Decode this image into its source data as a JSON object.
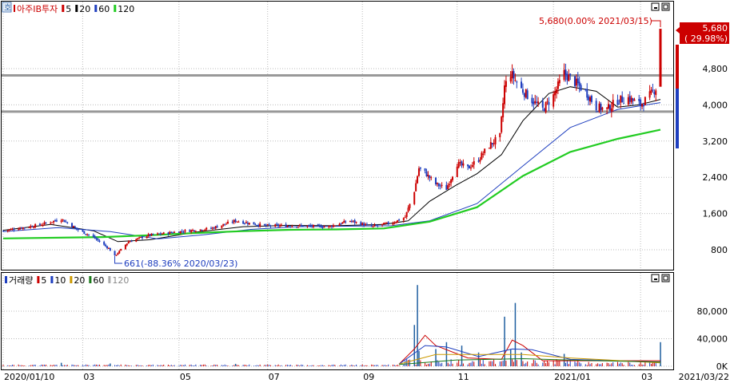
{
  "main_panel": {
    "corner_label": "호",
    "legend": [
      {
        "text": "아주IB투자",
        "color": "#cc0000"
      },
      {
        "text": "5",
        "color": "#000000",
        "swatch": "#cc0000"
      },
      {
        "text": "20",
        "color": "#000000",
        "swatch": "#000000"
      },
      {
        "text": "60",
        "color": "#000000",
        "swatch": "#1f3fbf"
      },
      {
        "text": "120",
        "color": "#000000",
        "swatch": "#22cc22"
      }
    ],
    "max_annotation": "5,680(0.00% 2021/03/15)",
    "min_annotation": "661(-88.36% 2020/03/23)",
    "last_price_label": "5,680",
    "last_change_label": "( 29.98%)"
  },
  "volume_panel": {
    "legend": [
      {
        "text": "거래량",
        "swatch": "#1f3fbf"
      },
      {
        "text": "5",
        "swatch": "#cc0000"
      },
      {
        "text": "10",
        "swatch": "#1f3fbf"
      },
      {
        "text": "20",
        "swatch": "#cc9900"
      },
      {
        "text": "60",
        "swatch": "#1a7a1a"
      },
      {
        "text": "120",
        "swatch": "#aaaaaa"
      }
    ]
  },
  "x_axis": {
    "labels": [
      {
        "text": "2020/01/10",
        "date": "2020-01-10"
      },
      {
        "text": "03",
        "date": "2020-03-02"
      },
      {
        "text": "05",
        "date": "2020-05-04"
      },
      {
        "text": "07",
        "date": "2020-07-01"
      },
      {
        "text": "09",
        "date": "2020-09-01"
      },
      {
        "text": "11",
        "date": "2020-11-02"
      },
      {
        "text": "2021/01",
        "date": "2021-01-04"
      },
      {
        "text": "03",
        "date": "2021-03-02"
      }
    ],
    "end_label": "2021/03/22"
  },
  "chart_data": [
    {
      "type": "candlestick",
      "title": "아주IB투자",
      "ylim": [
        400,
        6400
      ],
      "y_ticks": [
        800,
        1600,
        2400,
        3200,
        4000,
        4800
      ],
      "y_tick_labels": [
        "800",
        "1,600",
        "2,400",
        "3,200",
        "4,000",
        "4,800"
      ],
      "grid": true,
      "horizontal_lines": [
        4650,
        3850
      ],
      "x_range": [
        "2020-01-10",
        "2021-03-22"
      ],
      "close_series": [
        [
          "2020-01-10",
          1220
        ],
        [
          "2020-02-03",
          1350
        ],
        [
          "2020-02-17",
          1480
        ],
        [
          "2020-02-28",
          1240
        ],
        [
          "2020-03-09",
          1080
        ],
        [
          "2020-03-19",
          830
        ],
        [
          "2020-03-23",
          661
        ],
        [
          "2020-04-01",
          980
        ],
        [
          "2020-04-14",
          1120
        ],
        [
          "2020-05-04",
          1200
        ],
        [
          "2020-05-25",
          1270
        ],
        [
          "2020-06-10",
          1440
        ],
        [
          "2020-06-29",
          1330
        ],
        [
          "2020-07-20",
          1330
        ],
        [
          "2020-08-10",
          1310
        ],
        [
          "2020-08-24",
          1440
        ],
        [
          "2020-09-07",
          1310
        ],
        [
          "2020-09-21",
          1400
        ],
        [
          "2020-09-29",
          1520
        ],
        [
          "2020-10-05",
          2100
        ],
        [
          "2020-10-08",
          2600
        ],
        [
          "2020-10-12",
          2500
        ],
        [
          "2020-10-19",
          2250
        ],
        [
          "2020-10-26",
          2150
        ],
        [
          "2020-11-02",
          2700
        ],
        [
          "2020-11-09",
          2600
        ],
        [
          "2020-11-16",
          2800
        ],
        [
          "2020-11-23",
          3100
        ],
        [
          "2020-11-30",
          3300
        ],
        [
          "2020-12-03",
          4400
        ],
        [
          "2020-12-07",
          4700
        ],
        [
          "2020-12-14",
          4350
        ],
        [
          "2020-12-21",
          4100
        ],
        [
          "2020-12-28",
          3900
        ],
        [
          "2021-01-04",
          4200
        ],
        [
          "2021-01-11",
          4700
        ],
        [
          "2021-01-18",
          4500
        ],
        [
          "2021-01-25",
          4300
        ],
        [
          "2021-02-01",
          3950
        ],
        [
          "2021-02-08",
          3900
        ],
        [
          "2021-02-15",
          4100
        ],
        [
          "2021-02-22",
          4150
        ],
        [
          "2021-03-02",
          4000
        ],
        [
          "2021-03-08",
          4200
        ],
        [
          "2021-03-12",
          4370
        ],
        [
          "2021-03-15",
          5680
        ]
      ],
      "ma": [
        {
          "name": "5",
          "color": "#cc0000",
          "values": [
            [
              "2020-01-10",
              1220
            ],
            [
              "2020-03-23",
              700
            ],
            [
              "2020-10-08",
              2550
            ],
            [
              "2020-12-07",
              4650
            ],
            [
              "2021-03-12",
              4350
            ]
          ]
        },
        {
          "name": "20",
          "color": "#000000",
          "values": [
            [
              "2020-01-10",
              1230
            ],
            [
              "2020-02-10",
              1360
            ],
            [
              "2020-03-09",
              1220
            ],
            [
              "2020-03-25",
              980
            ],
            [
              "2020-04-15",
              1020
            ],
            [
              "2020-05-15",
              1190
            ],
            [
              "2020-06-15",
              1310
            ],
            [
              "2020-07-15",
              1340
            ],
            [
              "2020-08-15",
              1330
            ],
            [
              "2020-09-15",
              1360
            ],
            [
              "2020-10-01",
              1440
            ],
            [
              "2020-10-15",
              1870
            ],
            [
              "2020-11-01",
              2220
            ],
            [
              "2020-11-15",
              2480
            ],
            [
              "2020-12-01",
              2900
            ],
            [
              "2020-12-15",
              3650
            ],
            [
              "2021-01-01",
              4250
            ],
            [
              "2021-01-15",
              4400
            ],
            [
              "2021-02-01",
              4300
            ],
            [
              "2021-02-15",
              3950
            ],
            [
              "2021-03-01",
              4000
            ],
            [
              "2021-03-15",
              4120
            ]
          ]
        },
        {
          "name": "60",
          "color": "#1f3fbf",
          "values": [
            [
              "2020-01-10",
              1200
            ],
            [
              "2020-02-15",
              1290
            ],
            [
              "2020-03-20",
              1200
            ],
            [
              "2020-04-20",
              1040
            ],
            [
              "2020-05-20",
              1130
            ],
            [
              "2020-06-20",
              1250
            ],
            [
              "2020-07-20",
              1310
            ],
            [
              "2020-08-20",
              1320
            ],
            [
              "2020-09-20",
              1330
            ],
            [
              "2020-10-15",
              1440
            ],
            [
              "2020-11-15",
              1820
            ],
            [
              "2020-12-15",
              2650
            ],
            [
              "2021-01-15",
              3500
            ],
            [
              "2021-02-15",
              3900
            ],
            [
              "2021-03-15",
              4050
            ]
          ]
        },
        {
          "name": "120",
          "color": "#22cc22",
          "values": [
            [
              "2020-01-10",
              1050
            ],
            [
              "2020-03-15",
              1080
            ],
            [
              "2020-04-15",
              1120
            ],
            [
              "2020-05-15",
              1170
            ],
            [
              "2020-06-15",
              1210
            ],
            [
              "2020-07-15",
              1240
            ],
            [
              "2020-08-15",
              1250
            ],
            [
              "2020-09-15",
              1270
            ],
            [
              "2020-10-15",
              1420
            ],
            [
              "2020-11-15",
              1740
            ],
            [
              "2020-12-15",
              2430
            ],
            [
              "2021-01-15",
              2960
            ],
            [
              "2021-02-15",
              3250
            ],
            [
              "2021-03-15",
              3450
            ]
          ]
        }
      ]
    },
    {
      "type": "bar",
      "title": "거래량",
      "ylim": [
        0,
        125000
      ],
      "y_ticks": [
        0,
        40000,
        80000
      ],
      "y_tick_labels": [
        "0K",
        "40,000",
        "80,000"
      ],
      "grid": true,
      "spikes": [
        [
          "2020-02-17",
          5000
        ],
        [
          "2020-03-20",
          4000
        ],
        [
          "2020-06-10",
          3500
        ],
        [
          "2020-10-05",
          60000
        ],
        [
          "2020-10-07",
          118000
        ],
        [
          "2020-10-08",
          22000
        ],
        [
          "2020-10-19",
          25000
        ],
        [
          "2020-10-26",
          35000
        ],
        [
          "2020-11-05",
          30000
        ],
        [
          "2020-11-16",
          20000
        ],
        [
          "2020-12-03",
          72000
        ],
        [
          "2020-12-07",
          25000
        ],
        [
          "2020-12-10",
          92000
        ],
        [
          "2020-12-14",
          20000
        ],
        [
          "2021-01-11",
          18000
        ],
        [
          "2021-03-15",
          35000
        ]
      ],
      "ma": [
        {
          "name": "5",
          "color": "#cc0000",
          "values": [
            [
              "2020-09-25",
              3000
            ],
            [
              "2020-10-05",
              25000
            ],
            [
              "2020-10-12",
              45000
            ],
            [
              "2020-10-19",
              30000
            ],
            [
              "2020-11-09",
              12000
            ],
            [
              "2020-12-01",
              10000
            ],
            [
              "2020-12-08",
              38000
            ],
            [
              "2020-12-15",
              30000
            ],
            [
              "2020-12-28",
              8000
            ],
            [
              "2021-03-15",
              8000
            ]
          ]
        },
        {
          "name": "10",
          "color": "#1f3fbf",
          "values": [
            [
              "2020-09-25",
              3000
            ],
            [
              "2020-10-12",
              30000
            ],
            [
              "2020-10-26",
              28000
            ],
            [
              "2020-11-16",
              14000
            ],
            [
              "2020-12-08",
              25000
            ],
            [
              "2020-12-21",
              24000
            ],
            [
              "2021-01-15",
              10000
            ],
            [
              "2021-03-15",
              6000
            ]
          ]
        },
        {
          "name": "20",
          "color": "#cc9900",
          "values": [
            [
              "2020-09-25",
              3000
            ],
            [
              "2020-10-19",
              17000
            ],
            [
              "2020-11-16",
              17000
            ],
            [
              "2020-12-15",
              17000
            ],
            [
              "2021-01-15",
              12000
            ],
            [
              "2021-03-15",
              5000
            ]
          ]
        },
        {
          "name": "60",
          "color": "#1a7a1a",
          "values": [
            [
              "2020-09-25",
              2500
            ],
            [
              "2020-11-01",
              9000
            ],
            [
              "2020-12-15",
              11000
            ],
            [
              "2021-01-15",
              9000
            ],
            [
              "2021-03-15",
              6000
            ]
          ]
        }
      ]
    }
  ]
}
